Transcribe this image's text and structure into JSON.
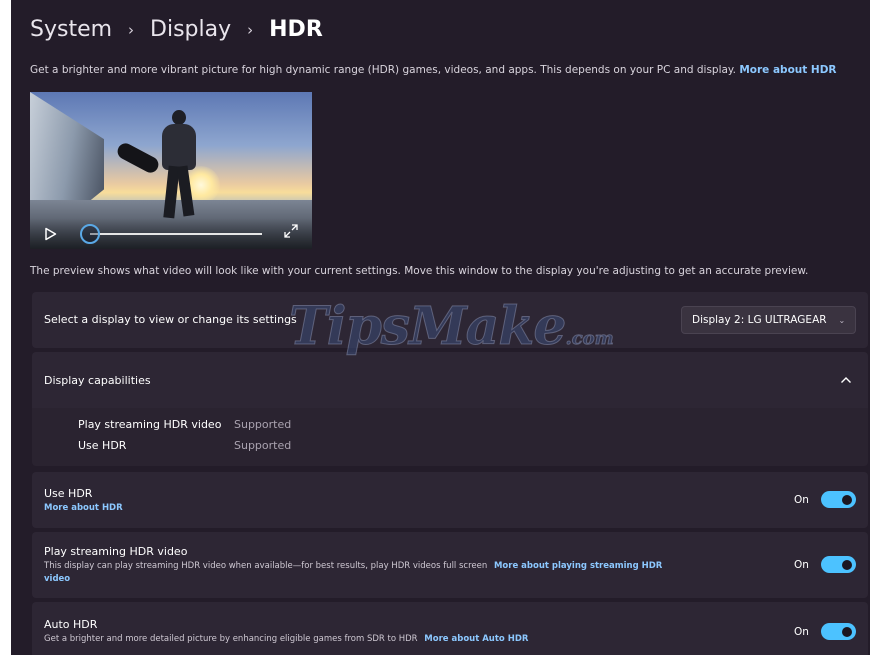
{
  "breadcrumb": {
    "items": [
      "System",
      "Display",
      "HDR"
    ],
    "separator": "›"
  },
  "intro": {
    "text": "Get a brighter and more vibrant picture for high dynamic range (HDR) games, videos, and apps. This depends on your PC and display.",
    "link": "More about HDR"
  },
  "video_preview": {
    "play_icon": "play-icon",
    "expand_icon": "expand-icon",
    "progress": 0.0
  },
  "preview_note": "The preview shows what video will look like with your current settings. Move this window to the display you're adjusting to get an accurate preview.",
  "display_select": {
    "label": "Select a display to view or change its settings",
    "selected": "Display 2: LG ULTRAGEAR",
    "chevron_icon": "chevron-down-icon"
  },
  "capabilities": {
    "title": "Display capabilities",
    "expanded": true,
    "chevron_icon": "chevron-up-icon",
    "items": [
      {
        "label": "Play streaming HDR video",
        "value": "Supported"
      },
      {
        "label": "Use HDR",
        "value": "Supported"
      }
    ]
  },
  "settings": {
    "use_hdr": {
      "title": "Use HDR",
      "link": "More about HDR",
      "state_label": "On",
      "on": true
    },
    "streaming_hdr": {
      "title": "Play streaming HDR video",
      "description": "This display can play streaming HDR video when available—for best results, play HDR videos full screen",
      "link_line1": "More about playing streaming HDR",
      "link_line2": "video",
      "state_label": "On",
      "on": true
    },
    "auto_hdr": {
      "title": "Auto HDR",
      "description": "Get a brighter and more detailed picture by enhancing eligible games from SDR to HDR",
      "link": "More about Auto HDR",
      "state_label": "On",
      "on": true
    }
  },
  "watermark": {
    "text": "TipsMake",
    "suffix": ".com"
  },
  "colors": {
    "background": "#231c29",
    "card": "#2d2634",
    "accent": "#4cc2ff",
    "link": "#8cc8ff"
  }
}
